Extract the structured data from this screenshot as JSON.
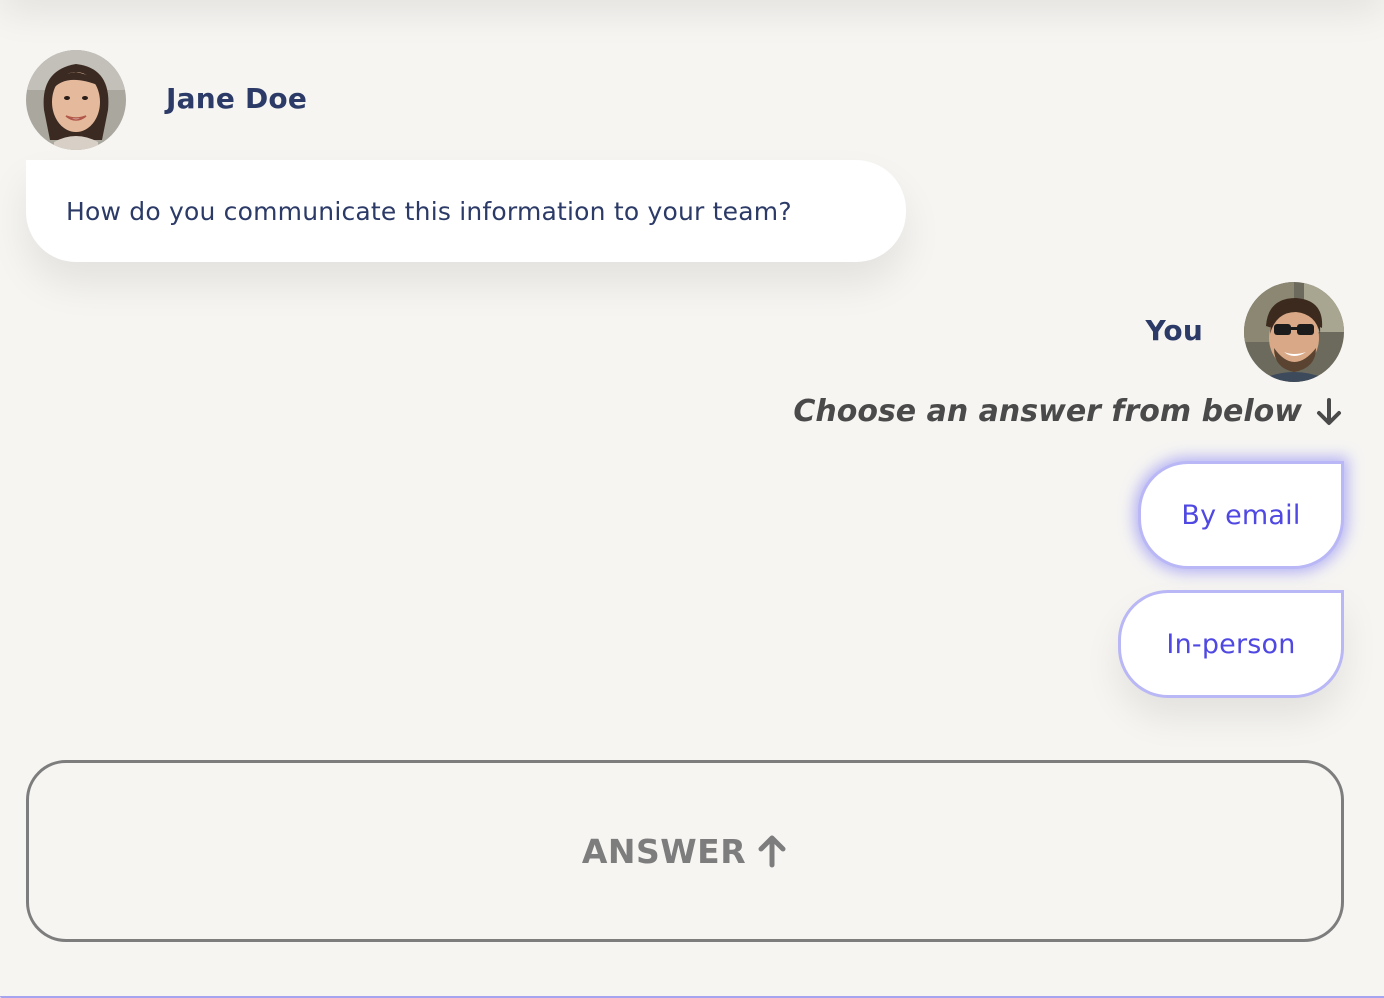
{
  "conversation": {
    "interviewer": {
      "name": "Jane Doe",
      "avatar_icon": "woman-portrait-avatar",
      "message": "How do you communicate this information to your team?"
    },
    "user": {
      "name": "You",
      "avatar_icon": "man-with-sunglasses-avatar"
    }
  },
  "answer_prompt": {
    "text": "Choose an answer from below",
    "icon": "arrow-down-icon"
  },
  "choices": [
    {
      "label": "By email",
      "state": "highlighted"
    },
    {
      "label": "In-person",
      "state": "default"
    }
  ],
  "answer_button": {
    "label": "ANSWER",
    "icon": "arrow-up-icon"
  },
  "colors": {
    "background": "#f6f5f2",
    "name_text": "#2b3a67",
    "choice_text": "#4f48e2",
    "choice_border": "#b9b7f5",
    "answer_button": "#7d7d7d"
  }
}
